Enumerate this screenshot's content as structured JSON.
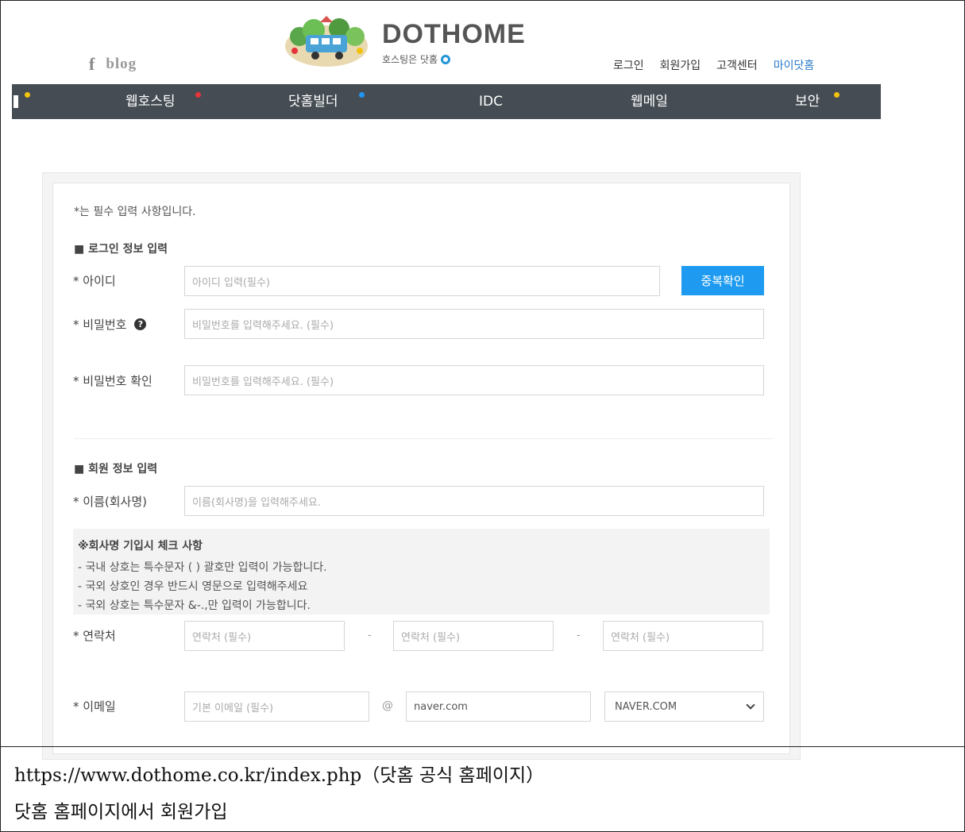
{
  "header": {
    "social": {
      "facebook": "f",
      "blog": "blog"
    },
    "logo": {
      "title": "DOTHOME",
      "slogan": "호스팅은 닷홈"
    },
    "topnav": [
      "로그인",
      "회원가입",
      "고객센터",
      "마이닷홈"
    ]
  },
  "gnb": {
    "items": [
      {
        "label": "",
        "dot": "yellow"
      },
      {
        "label": "웹호스팅",
        "dot": "red"
      },
      {
        "label": "닷홈빌더",
        "dot": "blue"
      },
      {
        "label": "IDC",
        "dot": ""
      },
      {
        "label": "웹메일",
        "dot": ""
      },
      {
        "label": "보안",
        "dot": "yellow"
      }
    ]
  },
  "form": {
    "required_note": "*는 필수 입력 사항입니다.",
    "login_section": "■ 로그인 정보 입력",
    "id_label": "* 아이디",
    "id_placeholder": "아이디 입력(필수)",
    "dup_check": "중복확인",
    "pw_label": "* 비밀번호",
    "pw_placeholder": "비밀번호를 입력해주세요. (필수)",
    "pw_confirm_label": "* 비밀번호 확인",
    "pw_confirm_placeholder": "비밀번호를 입력해주세요. (필수)",
    "member_section": "■ 회원 정보 입력",
    "name_label": "* 이름(회사명)",
    "name_placeholder": "이름(회사명)을 입력해주세요.",
    "notice": {
      "title": "※회사명 기입시 체크 사항",
      "lines": [
        "- 국내 상호는 특수문자 ( ) 괄호만 입력이 가능합니다.",
        "- 국외 상호인 경우 반드시 영문으로 입력해주세요",
        "- 국외 상호는 특수문자 &-.,만 입력이 가능합니다."
      ]
    },
    "phone_label": "* 연락처",
    "phone_placeholder": "연락처 (필수)",
    "phone_sep": "-",
    "email_label": "* 이메일",
    "email_placeholder": "기본 이메일 (필수)",
    "email_at": "@",
    "email_domain": "naver.com",
    "email_select": "NAVER.COM"
  },
  "caption": {
    "line1": "https://www.dothome.co.kr/index.php（닷홈 공식 홈페이지）",
    "line2": "닷홈 홈페이지에서 회원가입"
  },
  "colors": {
    "gnb_bg": "#454c53",
    "accent_blue": "#1e9bf0",
    "dot_yellow": "#f2c20f",
    "dot_red": "#e6333a",
    "dot_blue": "#2196f3"
  }
}
